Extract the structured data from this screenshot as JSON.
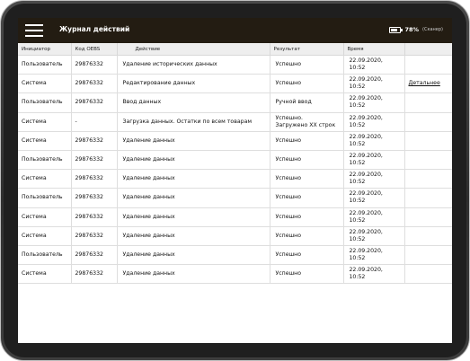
{
  "header": {
    "title": "Журнал действий",
    "battery_percent": "78%",
    "battery_note": "(Сканер)",
    "battery_level": 0.78
  },
  "table": {
    "columns": [
      "Инициатор",
      "Код OEBS",
      "Действие",
      "Результат",
      "Время",
      ""
    ],
    "rows": [
      {
        "initiator": "Пользователь",
        "code": "29876332",
        "action": "Удаление исторических данных",
        "result": "Успешно",
        "time": "22.09.2020, 10:52",
        "extra": ""
      },
      {
        "initiator": "Система",
        "code": "29876332",
        "action": "Редактирование данных",
        "result": "Успешно",
        "time": "22.09.2020, 10:52",
        "extra": "Детальнее"
      },
      {
        "initiator": "Пользователь",
        "code": "29876332",
        "action": "Ввод данных",
        "result": "Ручной ввод",
        "time": "22.09.2020, 10:52",
        "extra": ""
      },
      {
        "initiator": "Система",
        "code": "-",
        "action": "Загрузка данных. Остатки по всем товарам",
        "result": "Успешно.",
        "result2": "Загружено XX строк",
        "time": "22.09.2020, 10:52",
        "extra": ""
      },
      {
        "initiator": "Система",
        "code": "29876332",
        "action": "Удаление данных",
        "result": "Успешно",
        "time": "22.09.2020, 10:52",
        "extra": ""
      },
      {
        "initiator": "Пользователь",
        "code": "29876332",
        "action": "Удаление данных",
        "result": "Успешно",
        "time": "22.09.2020, 10:52",
        "extra": ""
      },
      {
        "initiator": "Система",
        "code": "29876332",
        "action": "Удаление данных",
        "result": "Успешно",
        "time": "22.09.2020, 10:52",
        "extra": ""
      },
      {
        "initiator": "Пользователь",
        "code": "29876332",
        "action": "Удаление данных",
        "result": "Успешно",
        "time": "22.09.2020, 10:52",
        "extra": ""
      },
      {
        "initiator": "Система",
        "code": "29876332",
        "action": "Удаление данных",
        "result": "Успешно",
        "time": "22.09.2020, 10:52",
        "extra": ""
      },
      {
        "initiator": "Система",
        "code": "29876332",
        "action": "Удаление данных",
        "result": "Успешно",
        "time": "22.09.2020, 10:52",
        "extra": ""
      },
      {
        "initiator": "Пользователь",
        "code": "29876332",
        "action": "Удаление данных",
        "result": "Успешно",
        "time": "22.09.2020, 10:52",
        "extra": ""
      },
      {
        "initiator": "Система",
        "code": "29876332",
        "action": "Удаление данных",
        "result": "Успешно",
        "time": "22.09.2020, 10:52",
        "extra": ""
      }
    ]
  },
  "icons": {
    "menu": "hamburger-menu-icon",
    "battery": "battery-icon"
  },
  "colors": {
    "topbar": "#231c12",
    "header_row": "#eeeeee",
    "device_frame": "#2f2f2f"
  }
}
